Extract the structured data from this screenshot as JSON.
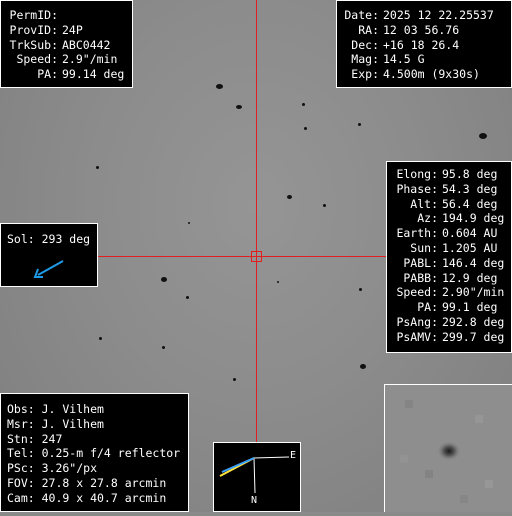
{
  "top_left": {
    "rows": [
      {
        "label": "PermID:",
        "value": ""
      },
      {
        "label": "ProvID:",
        "value": "24P"
      },
      {
        "label": "TrkSub:",
        "value": "ABC0442"
      },
      {
        "label": "Speed:",
        "value": "2.9\"/min"
      },
      {
        "label": "PA:",
        "value": "99.14 deg"
      }
    ]
  },
  "top_right": {
    "rows": [
      {
        "label": "Date:",
        "value": "2025 12 22.25537"
      },
      {
        "label": "RA:",
        "value": "12 03 56.76"
      },
      {
        "label": "Dec:",
        "value": "+16 18 26.4"
      },
      {
        "label": "Mag:",
        "value": "14.5 G"
      },
      {
        "label": "Exp:",
        "value": "4.500m (9x30s)"
      }
    ]
  },
  "right_mid": {
    "rows": [
      {
        "label": "Elong:",
        "value": "95.8 deg"
      },
      {
        "label": "Phase:",
        "value": "54.3 deg"
      },
      {
        "label": "Alt:",
        "value": "56.4 deg"
      },
      {
        "label": "Az:",
        "value": "194.9 deg"
      },
      {
        "label": "Earth:",
        "value": "0.604 AU"
      },
      {
        "label": "Sun:",
        "value": "1.205 AU"
      },
      {
        "label": "PABL:",
        "value": "146.4 deg"
      },
      {
        "label": "PABB:",
        "value": "12.9 deg"
      },
      {
        "label": "Speed:",
        "value": "2.90\"/min"
      },
      {
        "label": "PA:",
        "value": "99.1 deg"
      },
      {
        "label": "PsAng:",
        "value": "292.8 deg"
      },
      {
        "label": "PsAMV:",
        "value": "299.7 deg"
      }
    ]
  },
  "sol": {
    "text": "Sol: 293 deg",
    "arrow_color": "#1e9be8"
  },
  "bottom_left": {
    "rows": [
      "Obs: J. Vilhem",
      "Msr: J. Vilhem",
      "Stn: 247",
      "Tel: 0.25-m f/4 reflector",
      "PSc: 3.26\"/px",
      "FOV: 27.8 x 27.8 arcmin",
      "Cam: 40.9 x 40.7 arcmin"
    ]
  },
  "compass": {
    "east": "E",
    "north": "N",
    "motion_colors": [
      "#ffe23a",
      "#3aa0ff"
    ]
  },
  "crosshair_color": "#e02020",
  "icons": [
    "sun-direction-arrow-icon",
    "compass-icon",
    "target-marker-icon"
  ]
}
